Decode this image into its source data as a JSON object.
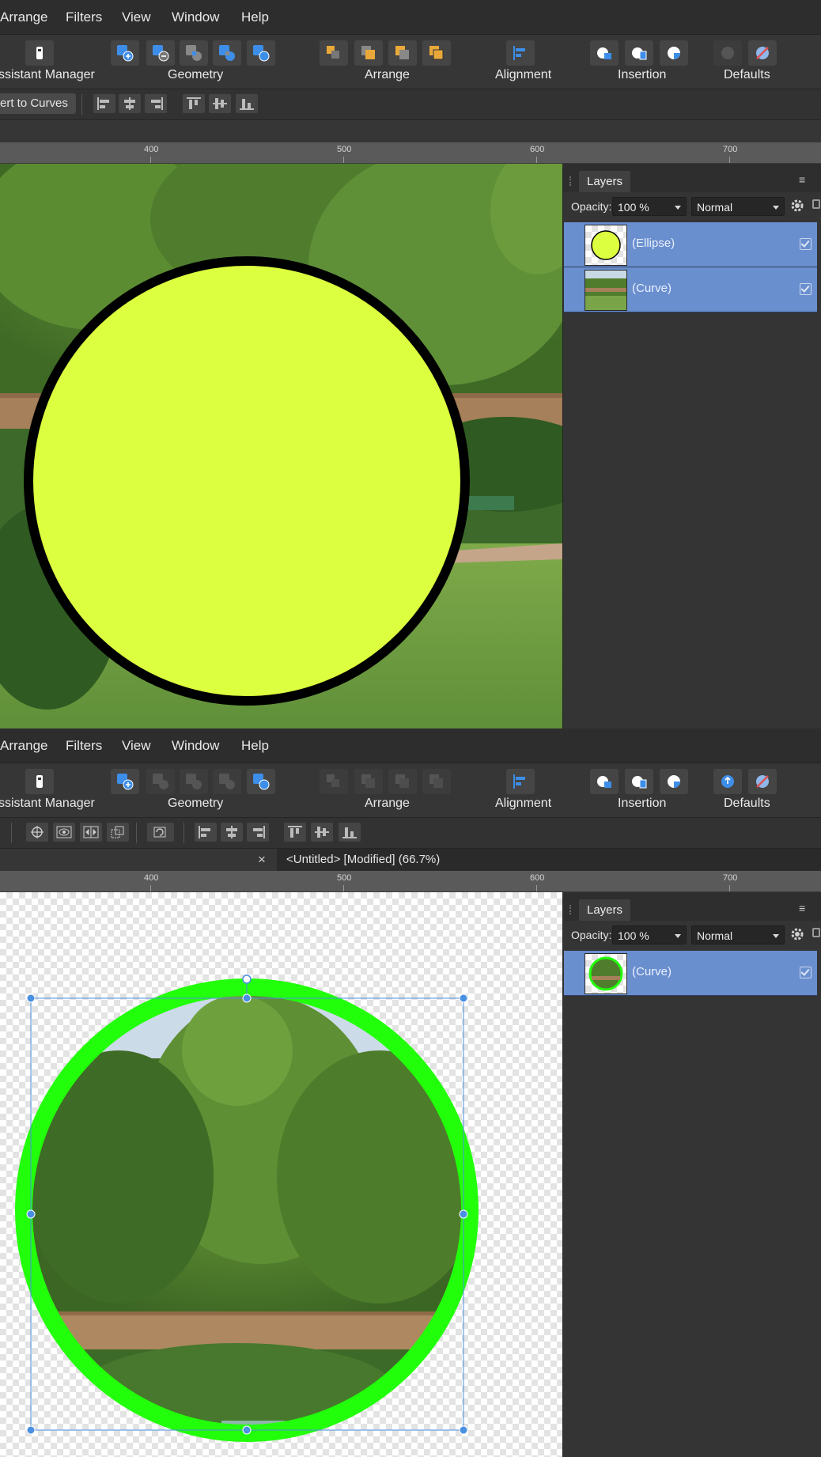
{
  "menu": [
    "Arrange",
    "Filters",
    "View",
    "Window",
    "Help"
  ],
  "toolbar_groups": {
    "assistant": "ssistant Manager",
    "geometry": "Geometry",
    "arrange": "Arrange",
    "alignment": "Alignment",
    "insertion": "Insertion",
    "defaults": "Defaults"
  },
  "icons": {
    "assistant": "assistant-manager-icon",
    "geometry": [
      "add-icon",
      "subtract-icon",
      "intersect-icon",
      "xor-icon",
      "divide-icon"
    ],
    "arrange": [
      "move-back-icon",
      "move-forward-icon",
      "to-back-icon",
      "to-front-icon"
    ],
    "alignment": "align-left-icon",
    "insertion": [
      "insert-behind-icon",
      "insert-top-icon",
      "insert-inside-icon"
    ],
    "defaults": [
      "sync-defaults-icon",
      "revert-defaults-icon"
    ]
  },
  "colors": {
    "accent": "#4a90e2",
    "layer_selected": "#6a8fcf",
    "ellipse_fill": "#dcff3f",
    "ellipse_stroke": "#000000",
    "ring_stroke": "#22ff0a"
  },
  "ruler_labels": [
    "400",
    "500",
    "600",
    "700"
  ],
  "screen1": {
    "convert_button": "ert to Curves",
    "layers_panel": {
      "tab": "Layers",
      "opacity_label": "Opacity:",
      "opacity_value": "100 %",
      "blend_mode": "Normal",
      "layers": [
        {
          "name": "(Ellipse)"
        },
        {
          "name": "(Curve)"
        }
      ]
    }
  },
  "screen2": {
    "document_tab": "<Untitled> [Modified] (66.7%)",
    "close_symbol": "×",
    "layers_panel": {
      "tab": "Layers",
      "opacity_label": "Opacity:",
      "opacity_value": "100 %",
      "blend_mode": "Normal",
      "layers": [
        {
          "name": "(Curve)"
        }
      ]
    }
  }
}
